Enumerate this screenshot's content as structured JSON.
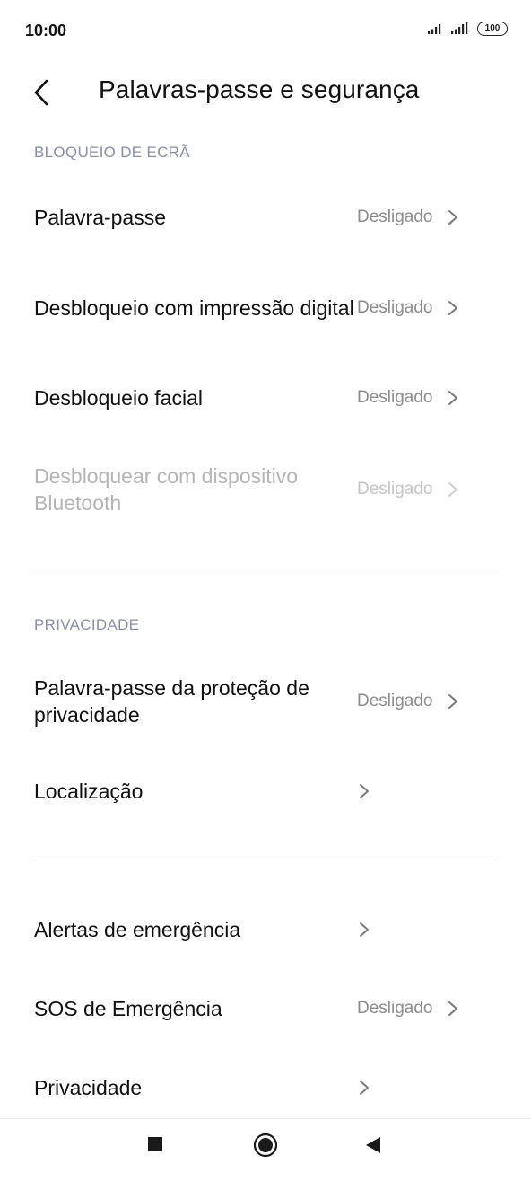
{
  "status_bar": {
    "time": "10:00",
    "battery": "100"
  },
  "header": {
    "title": "Palavras-passe e segurança"
  },
  "sections": {
    "lock_screen": {
      "title": "BLOQUEIO DE ECRÃ",
      "items": [
        {
          "label": "Palavra-passe",
          "value": "Desligado"
        },
        {
          "label": "Desbloqueio com impressão digital",
          "value": "Desligado"
        },
        {
          "label": "Desbloqueio facial",
          "value": "Desligado"
        },
        {
          "label": "Desbloquear com dispositivo Bluetooth",
          "value": "Desligado"
        }
      ]
    },
    "privacy": {
      "title": "PRIVACIDADE",
      "items": [
        {
          "label": "Palavra-passe da proteção de privacidade",
          "value": "Desligado"
        },
        {
          "label": "Localização"
        }
      ]
    },
    "other": {
      "items": [
        {
          "label": "Alertas de emergência"
        },
        {
          "label": "SOS de Emergência",
          "value": "Desligado"
        },
        {
          "label": "Privacidade"
        }
      ]
    }
  }
}
